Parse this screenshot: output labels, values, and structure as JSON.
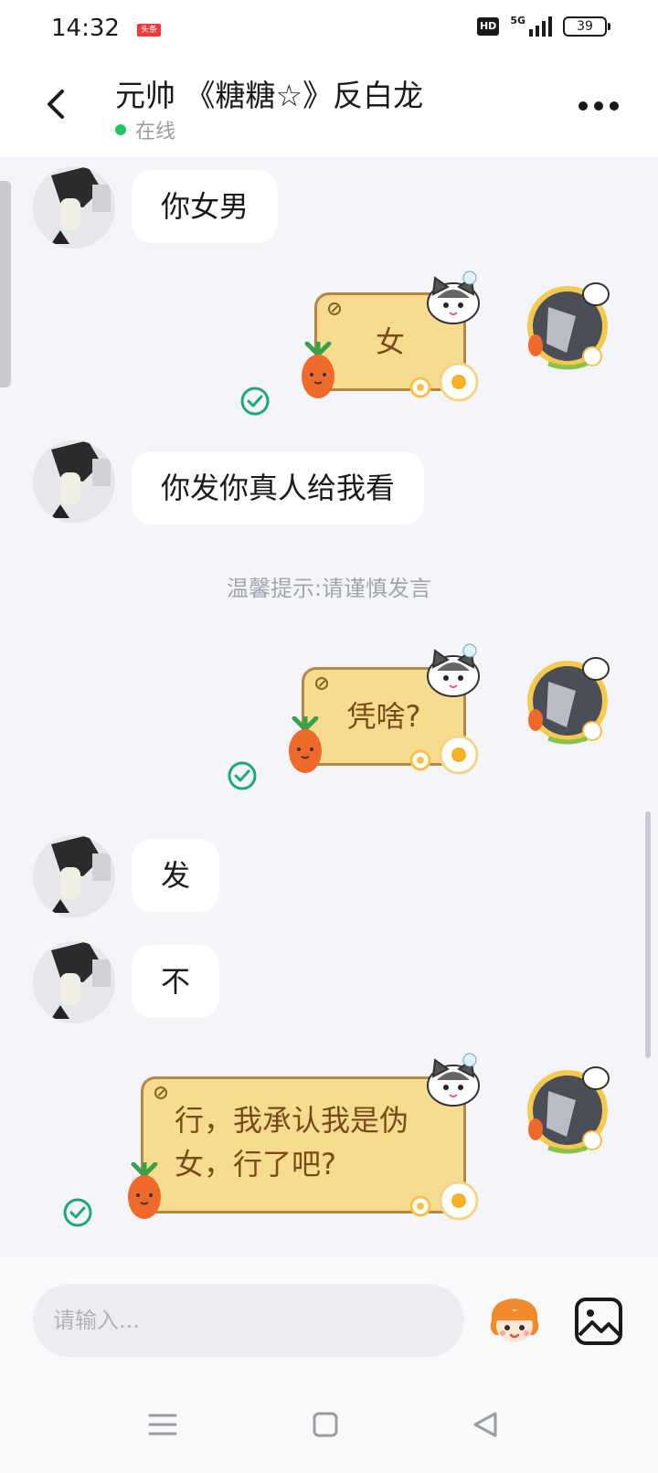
{
  "status_bar": {
    "time": "14:32",
    "app_badge": "头条",
    "hd_label": "HD",
    "network": "5G",
    "battery": "39"
  },
  "header": {
    "title": "元帅 《糖糖☆》反白龙",
    "status": "在线",
    "online_color": "#22c55e"
  },
  "messages": [
    {
      "side": "left",
      "text": "你女男"
    },
    {
      "side": "right",
      "text": "女",
      "read": true
    },
    {
      "side": "left",
      "text": "你发你真人给我看"
    },
    {
      "side": "system",
      "text": "温馨提示:请谨慎发言"
    },
    {
      "side": "right",
      "text": "凭啥?",
      "read": true
    },
    {
      "side": "left",
      "text": "发"
    },
    {
      "side": "left",
      "text": "不"
    },
    {
      "side": "right",
      "lines": [
        "行，我承认我是伪",
        "女，行了吧?"
      ],
      "read": true
    }
  ],
  "input": {
    "placeholder": "请输入..."
  },
  "colors": {
    "accent": "#21a67a",
    "bubble_right_fill": "#f7dc90",
    "bubble_right_border": "#b38842",
    "bubble_right_text": "#7a4a1a"
  },
  "icons": {
    "back": "chevron-left-icon",
    "more": "more-dots-icon",
    "read": "read-check-icon",
    "emoji": "emoji-face-icon",
    "image": "image-icon",
    "nav_menu": "menu-icon",
    "nav_home": "home-square-icon",
    "nav_back": "back-triangle-icon"
  }
}
